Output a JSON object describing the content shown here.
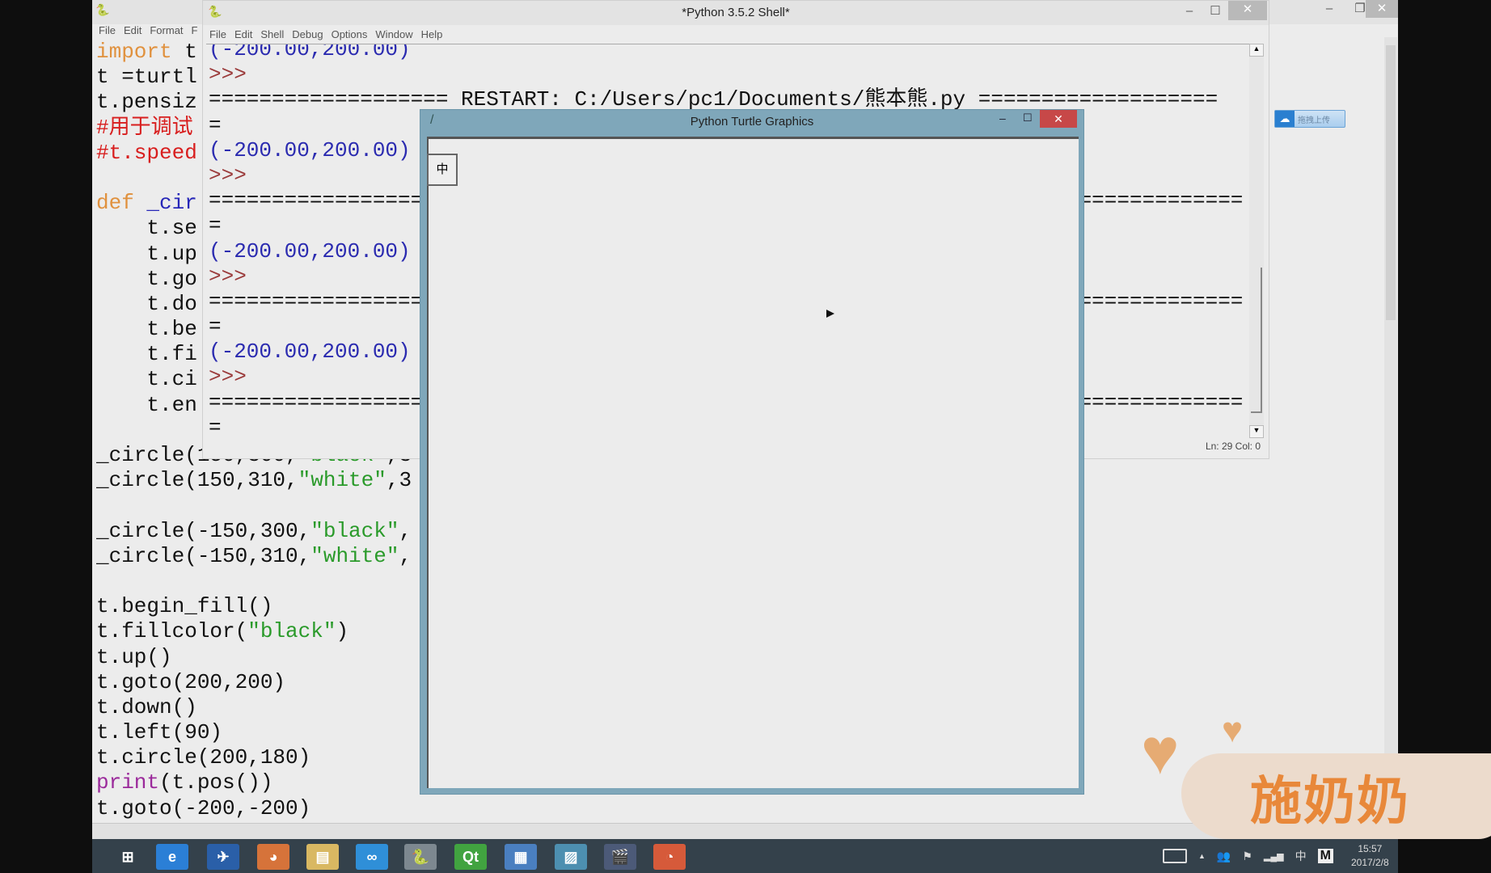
{
  "editor": {
    "menu": [
      "File",
      "Edit",
      "Format",
      "F"
    ],
    "lines": [
      [
        [
          "import",
          "kw"
        ],
        [
          " t",
          ""
        ]
      ],
      [
        [
          "t =turtl",
          ""
        ]
      ],
      [
        [
          "t.pensiz",
          ""
        ]
      ],
      [
        [
          "#用于调试",
          "cm"
        ]
      ],
      [
        [
          "#t.speed",
          "cm"
        ]
      ],
      [],
      [
        [
          "def",
          "kw"
        ],
        [
          " ",
          ""
        ],
        [
          "_cir",
          "fn"
        ]
      ],
      [
        [
          "    t.se",
          ""
        ]
      ],
      [
        [
          "    t.up",
          ""
        ]
      ],
      [
        [
          "    t.go",
          ""
        ]
      ],
      [
        [
          "    t.do",
          ""
        ]
      ],
      [
        [
          "    t.be",
          ""
        ]
      ],
      [
        [
          "    t.fi",
          ""
        ]
      ],
      [
        [
          "    t.ci",
          ""
        ]
      ],
      [
        [
          "    t.en",
          ""
        ]
      ],
      [],
      [
        [
          "_circle(150,300,",
          ""
        ],
        [
          "\"black\"",
          "st"
        ],
        [
          ",3",
          ""
        ]
      ],
      [
        [
          "_circle(150,310,",
          ""
        ],
        [
          "\"white\"",
          "st"
        ],
        [
          ",3",
          ""
        ]
      ],
      [],
      [
        [
          "_circle(-150,300,",
          ""
        ],
        [
          "\"black\"",
          "st"
        ],
        [
          ",",
          ""
        ]
      ],
      [
        [
          "_circle(-150,310,",
          ""
        ],
        [
          "\"white\"",
          "st"
        ],
        [
          ",",
          ""
        ]
      ],
      [],
      [
        [
          "t.begin_fill()",
          ""
        ]
      ],
      [
        [
          "t.fillcolor(",
          ""
        ],
        [
          "\"black\"",
          "st"
        ],
        [
          ")",
          ""
        ]
      ],
      [
        [
          "t.up()",
          ""
        ]
      ],
      [
        [
          "t.goto(200,200)",
          ""
        ]
      ],
      [
        [
          "t.down()",
          ""
        ]
      ],
      [
        [
          "t.left(90)",
          ""
        ]
      ],
      [
        [
          "t.circle(200,180)",
          ""
        ]
      ],
      [
        [
          "print",
          "bi"
        ],
        [
          "(t.pos())",
          ""
        ]
      ],
      [
        [
          "t.goto(-200,-200)",
          ""
        ]
      ]
    ]
  },
  "shell": {
    "title": "*Python 3.5.2 Shell*",
    "menu": [
      "File",
      "Edit",
      "Shell",
      "Debug",
      "Options",
      "Window",
      "Help"
    ],
    "lines": [
      [
        "(-200.00,200.00)",
        "out"
      ],
      [
        ">>>",
        "pr"
      ],
      [
        "=================== RESTART: C:/Users/pc1/Documents/熊本熊.py ===================",
        ""
      ],
      [
        "=",
        ""
      ],
      [
        "(-200.00,200.00)",
        "out"
      ],
      [
        ">>>",
        "pr"
      ],
      [
        "==================================================================================",
        ""
      ],
      [
        "=",
        ""
      ],
      [
        "(-200.00,200.00)",
        "out"
      ],
      [
        ">>>",
        "pr"
      ],
      [
        "==================================================================================",
        ""
      ],
      [
        "=",
        ""
      ],
      [
        "(-200.00,200.00)",
        "out"
      ],
      [
        ">>>",
        "pr"
      ],
      [
        "==================================================================================",
        ""
      ],
      [
        "=",
        ""
      ]
    ],
    "status": "Ln: 29  Col: 0"
  },
  "turtle": {
    "title": "Python Turtle Graphics",
    "ime": "中"
  },
  "baidu": {
    "label": "拖拽上传"
  },
  "watermark": {
    "text": "施奶奶"
  },
  "taskbar": {
    "icons": [
      "windows-start",
      "internet-explorer",
      "bird-app",
      "firefox",
      "file-explorer",
      "baidu-cloud",
      "python-idle",
      "qt-creator",
      "app-window",
      "photo-viewer",
      "video-editor",
      "media-app"
    ],
    "tray": {
      "ime": "中",
      "m": "M",
      "time": "15:57",
      "date": "2017/2/8"
    }
  }
}
